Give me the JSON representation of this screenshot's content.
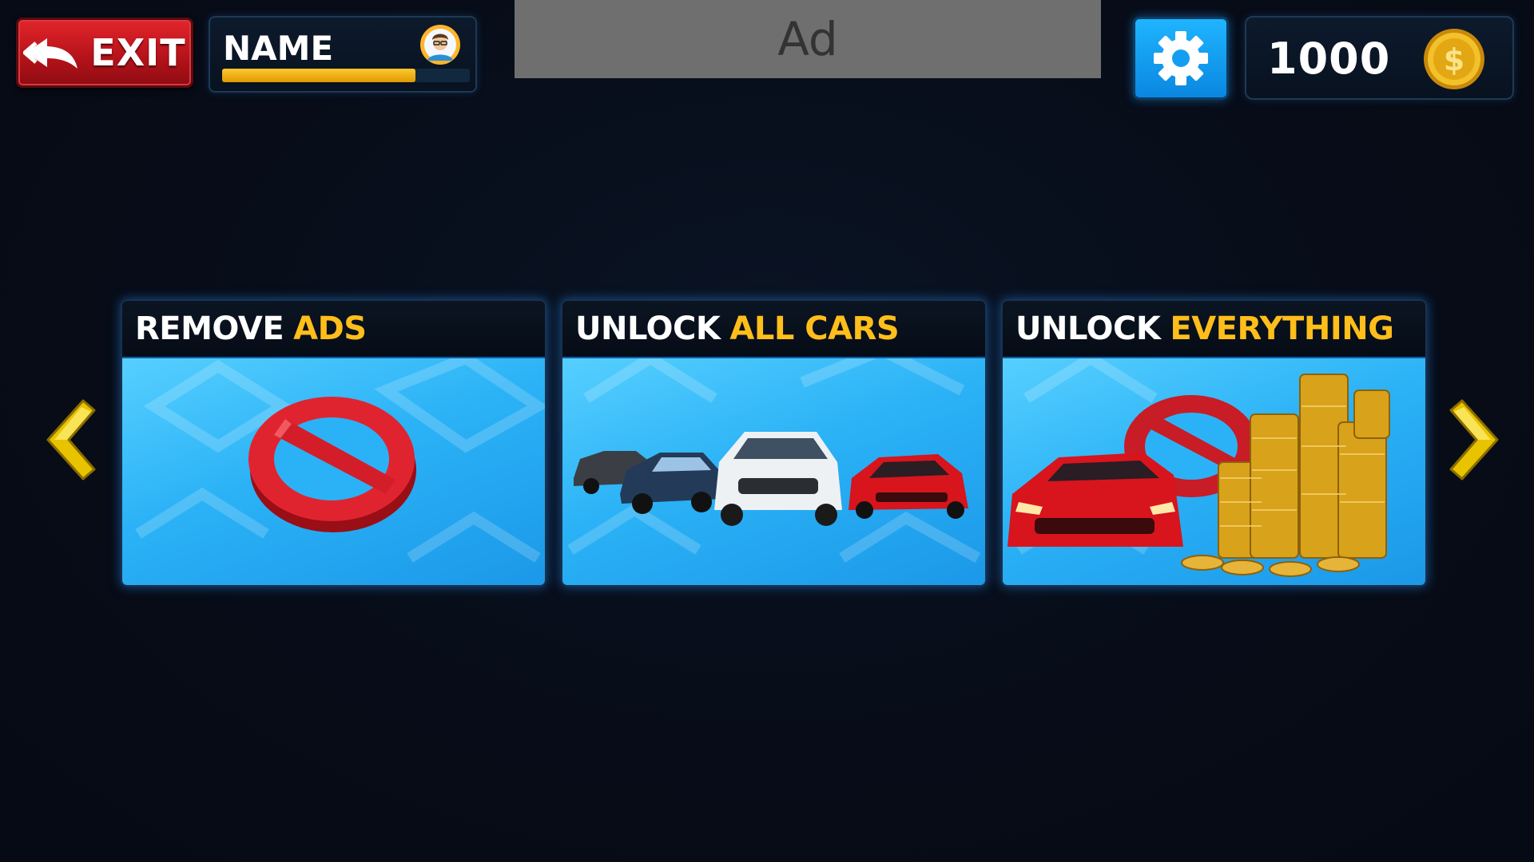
{
  "header": {
    "exit_label": "EXIT",
    "player_name": "NAME",
    "xp_progress": 0.78,
    "ad_label": "Ad",
    "coin_amount": "1000"
  },
  "shop": {
    "cards": [
      {
        "title": "REMOVE",
        "highlight": "ADS",
        "image": "no-ads-sign"
      },
      {
        "title": "UNLOCK",
        "highlight": "ALL CARS",
        "image": "cars-lineup"
      },
      {
        "title": "UNLOCK",
        "highlight": "EVERYTHING",
        "image": "red-car-with-gold-coins"
      }
    ]
  },
  "icons": {
    "exit": "back-arrow-icon",
    "avatar": "player-avatar-icon",
    "settings": "gear-icon",
    "coin": "dollar-coin-icon",
    "prev": "chevron-left-icon",
    "next": "chevron-right-icon"
  },
  "colors": {
    "exit_red": "#d71c24",
    "accent_yellow": "#ffbe1a",
    "settings_blue": "#12a0f5",
    "card_blue": "#2bb2f6",
    "background": "#070c18"
  }
}
